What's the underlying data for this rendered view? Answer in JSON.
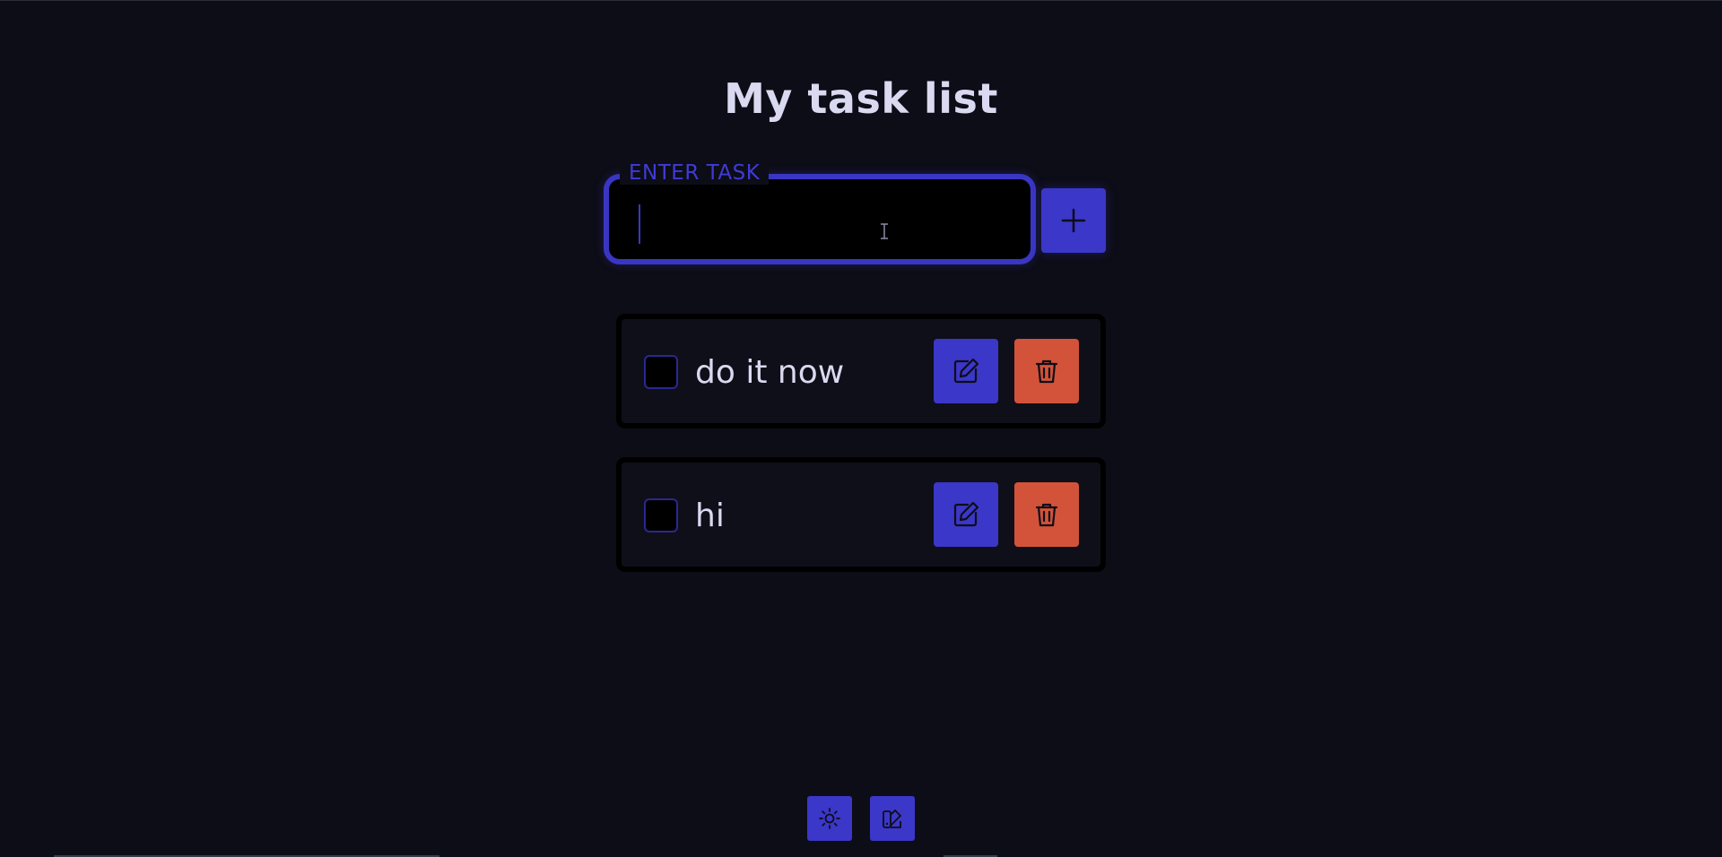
{
  "header": {
    "title": "My task list"
  },
  "task_input": {
    "label": "ENTER TASK",
    "value": "",
    "placeholder": ""
  },
  "add_button": {
    "icon": "plus-icon"
  },
  "tasks": [
    {
      "text": "do it now",
      "checked": false,
      "edit_icon": "pencil-icon",
      "delete_icon": "trash-icon"
    },
    {
      "text": "hi",
      "checked": false,
      "edit_icon": "pencil-icon",
      "delete_icon": "trash-icon"
    }
  ],
  "footer": {
    "theme_toggle_icon": "sun-icon",
    "palette_icon": "palette-icon"
  },
  "colors": {
    "background": "#0d0d17",
    "accent": "#3b37c8",
    "danger": "#d2533a",
    "text": "#d9d9f0"
  }
}
